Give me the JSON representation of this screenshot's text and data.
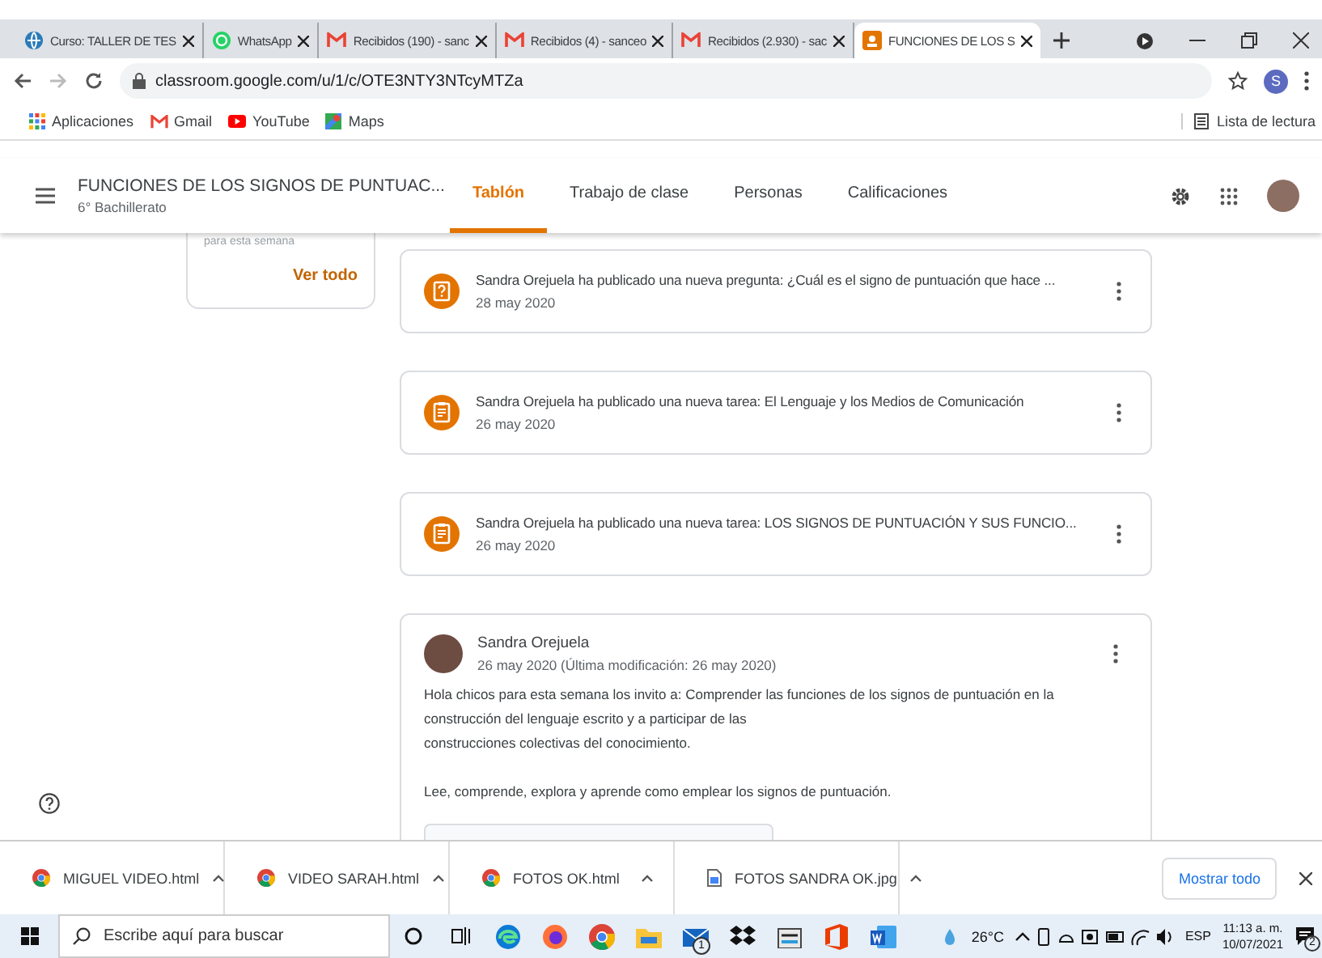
{
  "browser_tabs": [
    {
      "title": "Curso: TALLER DE TES",
      "kind": "moodle",
      "selected": false
    },
    {
      "title": "WhatsApp",
      "kind": "whatsapp",
      "selected": false
    },
    {
      "title": "Recibidos (190) - sanc",
      "kind": "gmail",
      "selected": false
    },
    {
      "title": "Recibidos (4) - sanceo",
      "kind": "gmail",
      "selected": false
    },
    {
      "title": "Recibidos (2.930) - sac",
      "kind": "gmail",
      "selected": false
    },
    {
      "title": "FUNCIONES DE LOS S",
      "kind": "classroom",
      "selected": true
    }
  ],
  "address": "classroom.google.com/u/1/c/OTE3NTY3NTcyMTZa",
  "profile_initial": "S",
  "bookmarks": [
    {
      "label": "Aplicaciones",
      "kind": "apps"
    },
    {
      "label": "Gmail",
      "kind": "gmail"
    },
    {
      "label": "YouTube",
      "kind": "youtube"
    },
    {
      "label": "Maps",
      "kind": "maps"
    }
  ],
  "reading_list": "Lista de lectura",
  "class_header": {
    "title": "FUNCIONES DE LOS SIGNOS DE PUNTUAC...",
    "subtitle": "6° Bachillerato",
    "tabs": [
      {
        "label": "Tablón",
        "selected": true
      },
      {
        "label": "Trabajo de clase",
        "selected": false
      },
      {
        "label": "Personas",
        "selected": false
      },
      {
        "label": "Calificaciones",
        "selected": false
      }
    ]
  },
  "upcoming": {
    "text": "para esta semana",
    "link": "Ver todo"
  },
  "stream": [
    {
      "kind": "question",
      "text": "Sandra Orejuela ha publicado una nueva pregunta: ¿Cuál es el signo de puntuación que hace ...",
      "date": "28 may 2020"
    },
    {
      "kind": "assignment",
      "text": "Sandra Orejuela ha publicado una nueva tarea: El Lenguaje y los Medios de Comunicación",
      "date": "26 may 2020"
    },
    {
      "kind": "assignment",
      "text": "Sandra Orejuela ha publicado una nueva tarea: LOS SIGNOS DE PUNTUACIÓN Y SUS FUNCIO...",
      "date": "26 may 2020"
    }
  ],
  "announcement": {
    "author": "Sandra Orejuela",
    "date": "26 may 2020 (Última modificación: 26 may 2020)",
    "paragraphs": [
      {
        "lines": [
          "Hola chicos para esta semana los invito a: Comprender las funciones de los signos de puntuación en la construcción del lenguaje escrito y a participar de las",
          "construcciones colectivas del conocimiento."
        ]
      },
      {
        "lines": [
          "Lee, comprende, explora y aprende como emplear los signos de puntuación."
        ]
      }
    ]
  },
  "downloads": [
    {
      "name": "MIGUEL VIDEO.html",
      "kind": "chrome"
    },
    {
      "name": "VIDEO SARAH.html",
      "kind": "chrome"
    },
    {
      "name": "FOTOS OK.html",
      "kind": "chrome"
    },
    {
      "name": "FOTOS SANDRA OK.jpg",
      "kind": "image"
    }
  ],
  "show_all": "Mostrar todo",
  "taskbar": {
    "search_placeholder": "Escribe aquí para buscar",
    "apps": [
      {
        "kind": "cortana"
      },
      {
        "kind": "taskview"
      },
      {
        "kind": "edge"
      },
      {
        "kind": "firefox"
      },
      {
        "kind": "chrome"
      },
      {
        "kind": "explorer"
      },
      {
        "kind": "mail",
        "badge": "1"
      },
      {
        "kind": "dropbox"
      },
      {
        "kind": "store"
      },
      {
        "kind": "office"
      },
      {
        "kind": "word"
      }
    ],
    "temperature": "26°C",
    "language": "ESP",
    "time": "11:13 a. m.",
    "date": "10/07/2021",
    "notification_count": "2"
  }
}
